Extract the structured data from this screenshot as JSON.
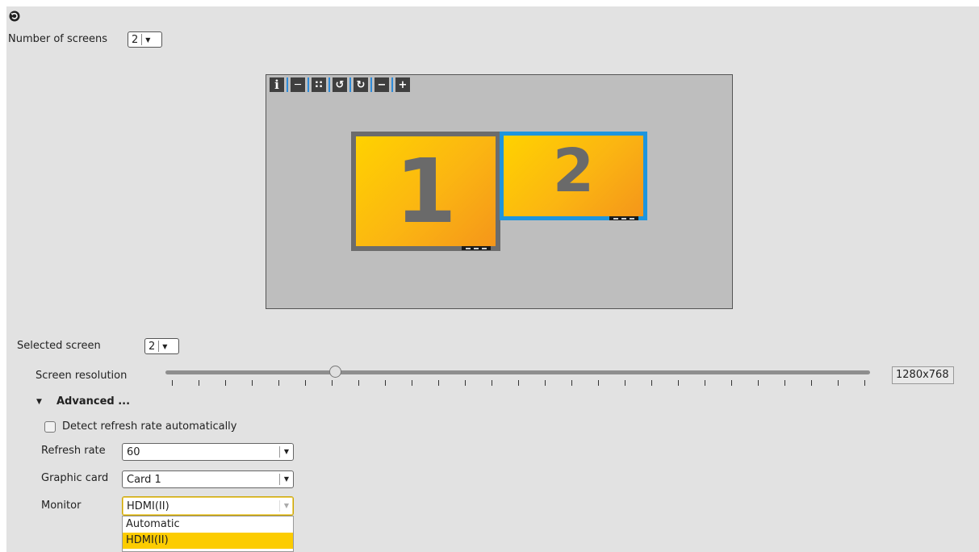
{
  "top": {
    "refresh_icon": "reload-icon",
    "number_of_screens_label": "Number of screens",
    "number_of_screens_value": "2"
  },
  "preview": {
    "toolbar": [
      {
        "icon": "info-icon",
        "glyph": "i"
      },
      {
        "icon": "layout-row-icon",
        "glyph": "─"
      },
      {
        "icon": "layout-grid-icon",
        "glyph": "∷"
      },
      {
        "icon": "rotate-left-icon",
        "glyph": "↺"
      },
      {
        "icon": "rotate-right-icon",
        "glyph": "↻"
      },
      {
        "icon": "zoom-out-icon",
        "glyph": "−"
      },
      {
        "icon": "zoom-in-icon",
        "glyph": "+"
      }
    ],
    "screens": [
      {
        "number": "1",
        "selected": false
      },
      {
        "number": "2",
        "selected": true
      }
    ],
    "colors": {
      "screen_fill_start": "#ffd200",
      "screen_fill_end": "#f5961a",
      "selected_border": "#1e95de",
      "unselected_border": "#6c6c6c"
    }
  },
  "selected_screen": {
    "label": "Selected screen",
    "value": "2"
  },
  "resolution": {
    "label": "Screen resolution",
    "value": "1280x768",
    "slider_fraction": 0.24,
    "tick_count": 27
  },
  "advanced": {
    "toggle_glyph": "▼",
    "label": "Advanced ...",
    "detect_label": "Detect refresh rate automatically",
    "detect_checked": false,
    "refresh_rate_label": "Refresh rate",
    "refresh_rate_value": "60",
    "graphic_card_label": "Graphic card",
    "graphic_card_value": "Card 1",
    "monitor_label": "Monitor",
    "monitor_value": "HDMI(II)",
    "monitor_options": [
      "Automatic",
      "HDMI(II)"
    ],
    "monitor_selected_index": 1
  }
}
